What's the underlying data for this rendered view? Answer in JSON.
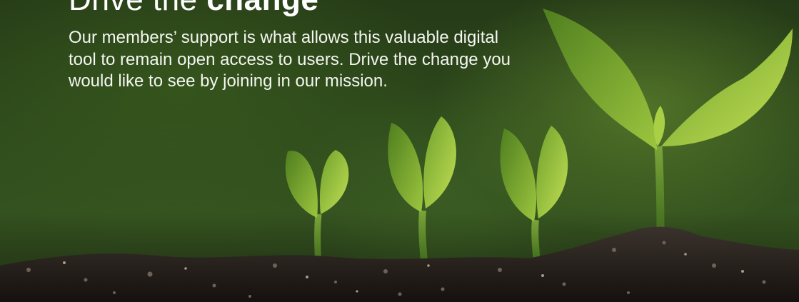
{
  "hero": {
    "headline_light": "Drive the",
    "headline_bold": "change",
    "body": "Our members’ support is what allows this valuable digital tool to remain open access to users. Drive the change you would like to see by joining in our mission."
  },
  "colors": {
    "text": "#ffffff",
    "leaf_light": "#b8d84a",
    "leaf_dark": "#5f8f24",
    "soil": "#2a2420"
  }
}
